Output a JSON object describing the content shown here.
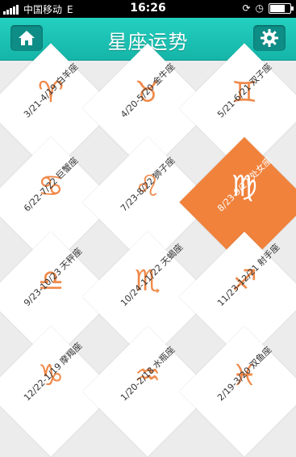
{
  "status_bar": {
    "carrier": "中国移动",
    "network": "E",
    "time": "16:26"
  },
  "header": {
    "title": "星座运势",
    "home_icon": "home-icon",
    "settings_icon": "gear-icon"
  },
  "signs": [
    {
      "symbol": "♈",
      "dates": "3/21-4/19",
      "name": "白羊座"
    },
    {
      "symbol": "♉",
      "dates": "4/20-5/20",
      "name": "金牛座"
    },
    {
      "symbol": "♊",
      "dates": "5/21-6/21",
      "name": "双子座"
    },
    {
      "symbol": "♋",
      "dates": "6/22-7/22",
      "name": "巨蟹座"
    },
    {
      "symbol": "♌",
      "dates": "7/23-8/22",
      "name": "狮子座"
    },
    {
      "symbol": "♍",
      "dates": "8/23-9/22",
      "name": "处女座",
      "selected": true
    },
    {
      "symbol": "♎",
      "dates": "9/23-10/23",
      "name": "天秤座"
    },
    {
      "symbol": "♏",
      "dates": "10/24-11/22",
      "name": "天蝎座"
    },
    {
      "symbol": "♐",
      "dates": "11/23-12/21",
      "name": "射手座"
    },
    {
      "symbol": "♑",
      "dates": "12/22-1/19",
      "name": "摩羯座"
    },
    {
      "symbol": "♒",
      "dates": "1/20-2/18",
      "name": "水瓶座"
    },
    {
      "symbol": "♓",
      "dates": "2/19-3/20",
      "name": "双鱼座"
    }
  ],
  "colors": {
    "header": "#1cc2b4",
    "accent": "#f0823c",
    "tile": "#ffffff"
  }
}
